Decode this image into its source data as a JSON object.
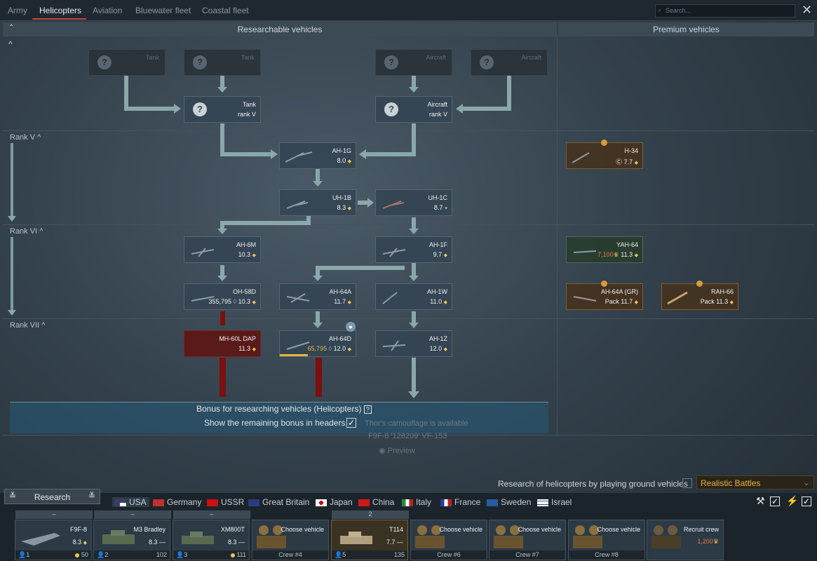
{
  "tabs": [
    "Army",
    "Helicopters",
    "Aviation",
    "Bluewater fleet",
    "Coastal fleet"
  ],
  "search_placeholder": "Search...",
  "panels": {
    "left": "Researchable vehicles",
    "right": "Premium vehicles"
  },
  "ranks": [
    "Rank V",
    "Rank VI",
    "Rank VII"
  ],
  "prereq": {
    "tank_label": "Tank",
    "aircraft_label": "Aircraft",
    "tank_title": "Tank",
    "tank_rank": "rank V",
    "aircraft_title": "Aircraft",
    "aircraft_rank": "rank V"
  },
  "vehicles": {
    "ah1g": {
      "name": "AH-1G",
      "br": "8.0"
    },
    "uh1b": {
      "name": "UH-1B",
      "br": "8.3"
    },
    "uh1c": {
      "name": "UH-1C",
      "br": "8.7"
    },
    "ah6m": {
      "name": "AH-6M",
      "br": "10.3"
    },
    "ah1f": {
      "name": "AH-1F",
      "br": "9.7"
    },
    "oh58d": {
      "name": "OH-58D",
      "br": "10.3",
      "rp": "355,795"
    },
    "ah64a": {
      "name": "AH-64A",
      "br": "11.7"
    },
    "ah1w": {
      "name": "AH-1W",
      "br": "11.0"
    },
    "mh60l": {
      "name": "MH-60L DAP",
      "br": "11.3"
    },
    "ah64d": {
      "name": "AH-64D",
      "br": "12.0",
      "rp": "65,795"
    },
    "ah1z": {
      "name": "AH-1Z",
      "br": "12.0"
    }
  },
  "premium": {
    "h34": {
      "name": "H-34",
      "br": "7.7"
    },
    "yah64": {
      "name": "YAH-64",
      "br": "11.3",
      "price": "7,100"
    },
    "ah64agr": {
      "name": "AH-64A (GR)",
      "br": "11.7",
      "pack": "Pack"
    },
    "rah66": {
      "name": "RAH-66",
      "br": "11.3",
      "pack": "Pack"
    }
  },
  "bonus": {
    "title": "Bonus for researching vehicles (Helicopters)",
    "help": "?",
    "show_remaining": "Show the remaining bonus in headers"
  },
  "faint": {
    "line1": "Thor's camouflage is available",
    "line2": "F9F-8 '128209' VF-153",
    "line3": "Preview"
  },
  "research_ground": "Research of helicopters by playing ground vehicles",
  "mode": "Realistic Battles",
  "research_button": "Research",
  "nations": [
    "USA",
    "Germany",
    "USSR",
    "Great Britain",
    "Japan",
    "China",
    "Italy",
    "France",
    "Sweden",
    "Israel"
  ],
  "slots": [
    {
      "hd": "–",
      "name": "F9F-8",
      "br": "8.3",
      "n": "1",
      "cost": "50"
    },
    {
      "hd": "–",
      "name": "M3 Bradley",
      "br": "8.3",
      "n": "2",
      "cost": "102"
    },
    {
      "hd": "–",
      "name": "XM800T",
      "br": "8.3",
      "n": "3",
      "cost": "111"
    },
    {
      "name": "Choose vehicle",
      "crew": "Crew #4"
    },
    {
      "hd": "2",
      "name": "T114",
      "br": "7.7",
      "n": "5",
      "cost": "135"
    },
    {
      "name": "Choose vehicle",
      "crew": "Crew #6"
    },
    {
      "name": "Choose vehicle",
      "crew": "Crew #7"
    },
    {
      "name": "Choose vehicle",
      "crew": "Crew #8"
    },
    {
      "name": "Recruit crew",
      "cost": "1,200"
    }
  ],
  "colors": {
    "accent": "#c84040",
    "gold": "#e6b446"
  }
}
